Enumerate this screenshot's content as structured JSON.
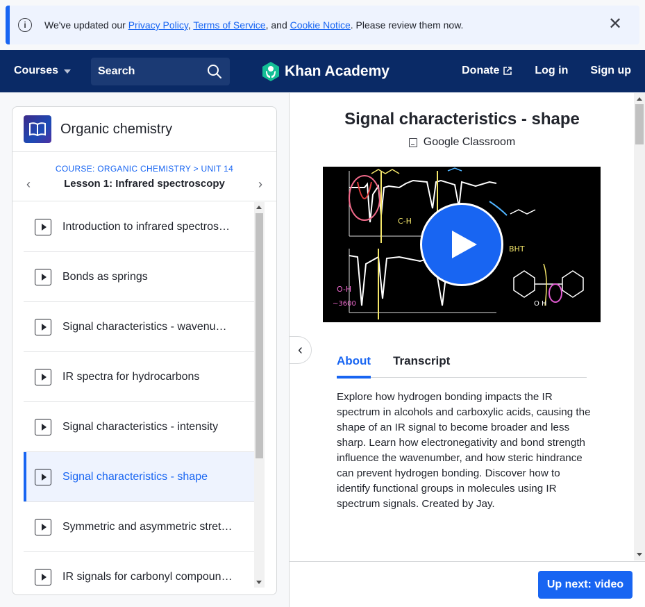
{
  "notice": {
    "prefix": "We've updated our ",
    "privacy": "Privacy Policy",
    "sep1": ", ",
    "terms": "Terms of Service",
    "sep2": ", and ",
    "cookie": "Cookie Notice",
    "suffix": ". Please review them now.",
    "close_icon": "close-icon",
    "info_icon": "info-icon"
  },
  "header": {
    "courses": "Courses",
    "search": "Search",
    "logo": "Khan Academy",
    "donate": "Donate",
    "login": "Log in",
    "signup": "Sign up"
  },
  "sidebar": {
    "course_title": "Organic chemistry",
    "breadcrumb": "COURSE: ORGANIC CHEMISTRY > UNIT 14",
    "lesson": "Lesson 1: Infrared spectroscopy",
    "items": [
      {
        "label": "Introduction to infrared spectroscopy",
        "active": false
      },
      {
        "label": "Bonds as springs",
        "active": false
      },
      {
        "label": "Signal characteristics - wavenumber",
        "active": false
      },
      {
        "label": "IR spectra for hydrocarbons",
        "active": false
      },
      {
        "label": "Signal characteristics - intensity",
        "active": false
      },
      {
        "label": "Signal characteristics - shape",
        "active": true
      },
      {
        "label": "Symmetric and asymmetric stretching",
        "active": false
      },
      {
        "label": "IR signals for carbonyl compounds",
        "active": false
      }
    ]
  },
  "main": {
    "title": "Signal characteristics - shape",
    "google_classroom": "Google Classroom",
    "tabs": [
      "About",
      "Transcript"
    ],
    "active_tab": "About",
    "about": "Explore how hydrogen bonding impacts the IR spectrum in alcohols and carboxylic acids, causing the shape of an IR signal to become broader and less sharp. Learn how electronegativity and bond strength influence the wavenumber, and how steric hindrance can prevent hydrogen bonding. Discover how to identify functional groups in molecules using IR spectrum signals. Created by Jay.",
    "up_next": "Up next: video"
  },
  "colors": {
    "brand_blue": "#1865f2",
    "header_navy": "#0a2a66",
    "logo_green": "#14bf96"
  }
}
